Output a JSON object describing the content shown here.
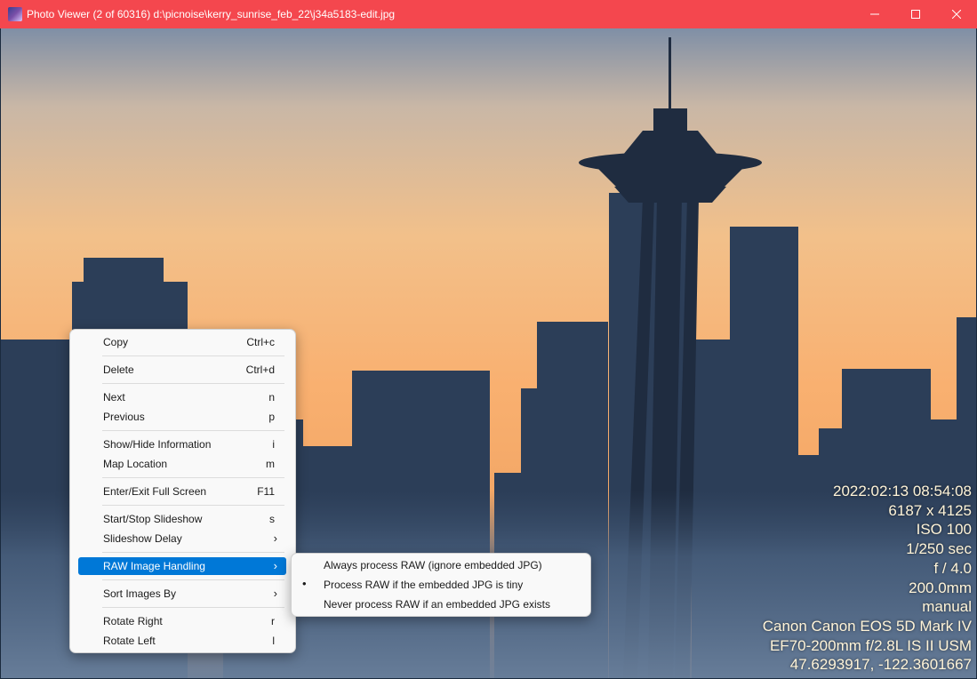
{
  "window": {
    "title": "Photo Viewer (2 of 60316) d:\\picnoise\\kerry_sunrise_feb_22\\j34a5183-edit.jpg",
    "accent": "#f4474e"
  },
  "context_menu": {
    "items": [
      {
        "label": "Copy",
        "shortcut": "Ctrl+c"
      },
      {
        "label": "Delete",
        "shortcut": "Ctrl+d"
      },
      {
        "label": "Next",
        "shortcut": "n"
      },
      {
        "label": "Previous",
        "shortcut": "p"
      },
      {
        "label": "Show/Hide Information",
        "shortcut": "i"
      },
      {
        "label": "Map Location",
        "shortcut": "m"
      },
      {
        "label": "Enter/Exit Full Screen",
        "shortcut": "F11"
      },
      {
        "label": "Start/Stop Slideshow",
        "shortcut": "s"
      },
      {
        "label": "Slideshow Delay",
        "submenu_arrow": "›"
      },
      {
        "label": "RAW Image Handling",
        "submenu_arrow": "›",
        "highlighted": true
      },
      {
        "label": "Sort Images By",
        "submenu_arrow": "›"
      },
      {
        "label": "Rotate Right",
        "shortcut": "r"
      },
      {
        "label": "Rotate Left",
        "shortcut": "l"
      }
    ]
  },
  "raw_submenu": {
    "items": [
      {
        "label": "Always process RAW (ignore embedded JPG)",
        "bullet": ""
      },
      {
        "label": "Process RAW if the embedded JPG is tiny",
        "bullet": "•"
      },
      {
        "label": "Never process RAW if an embedded JPG exists",
        "bullet": ""
      }
    ]
  },
  "image_info": {
    "datetime": "2022:02:13 08:54:08",
    "dimensions": "6187 x 4125",
    "iso": "ISO 100",
    "shutter": "1/250 sec",
    "aperture": "f / 4.0",
    "focal_length": "200.0mm",
    "mode": "manual",
    "camera": "Canon Canon EOS 5D Mark IV",
    "lens": "EF70-200mm f/2.8L IS II USM",
    "gps": "47.6293917, -122.3601667"
  }
}
